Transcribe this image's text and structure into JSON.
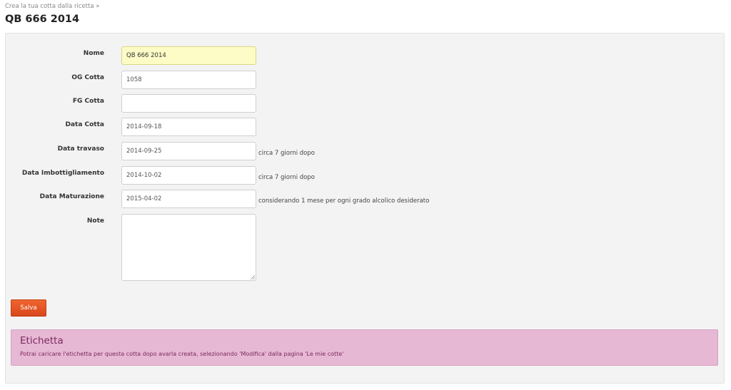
{
  "header": {
    "breadcrumb": "Crea la tua cotta dalla ricetta »",
    "title": "QB 666 2014"
  },
  "form": {
    "fields": [
      {
        "label": "Nome",
        "value": "QB 666 2014",
        "note": ""
      },
      {
        "label": "OG Cotta",
        "value": "1058",
        "note": ""
      },
      {
        "label": "FG Cotta",
        "value": "",
        "note": ""
      },
      {
        "label": "Data Cotta",
        "value": "2014-09-18",
        "note": ""
      },
      {
        "label": "Data travaso",
        "value": "2014-09-25",
        "note": "circa 7 giorni dopo"
      },
      {
        "label": "Data Imbottigliamento",
        "value": "2014-10-02",
        "note": "circa 7 giorni dopo"
      },
      {
        "label": "Data Maturazione",
        "value": "2015-04-02",
        "note": "considerando 1 mese per ogni grado alcolico desiderato"
      }
    ],
    "notes_label": "Note",
    "notes_value": "",
    "save_label": "Salva"
  },
  "alert": {
    "title": "Etichetta",
    "text": "Potrai caricare l'etichetta per questa cotta dopo avarla creata, selezionando 'Modifica' dalla pagina 'Le mie cotte'"
  },
  "colors": {
    "save_button": "#e2522a",
    "alert_background": "#e6b8d4",
    "alert_text": "#7b2960",
    "highlight_field": "#fdfcc6"
  }
}
